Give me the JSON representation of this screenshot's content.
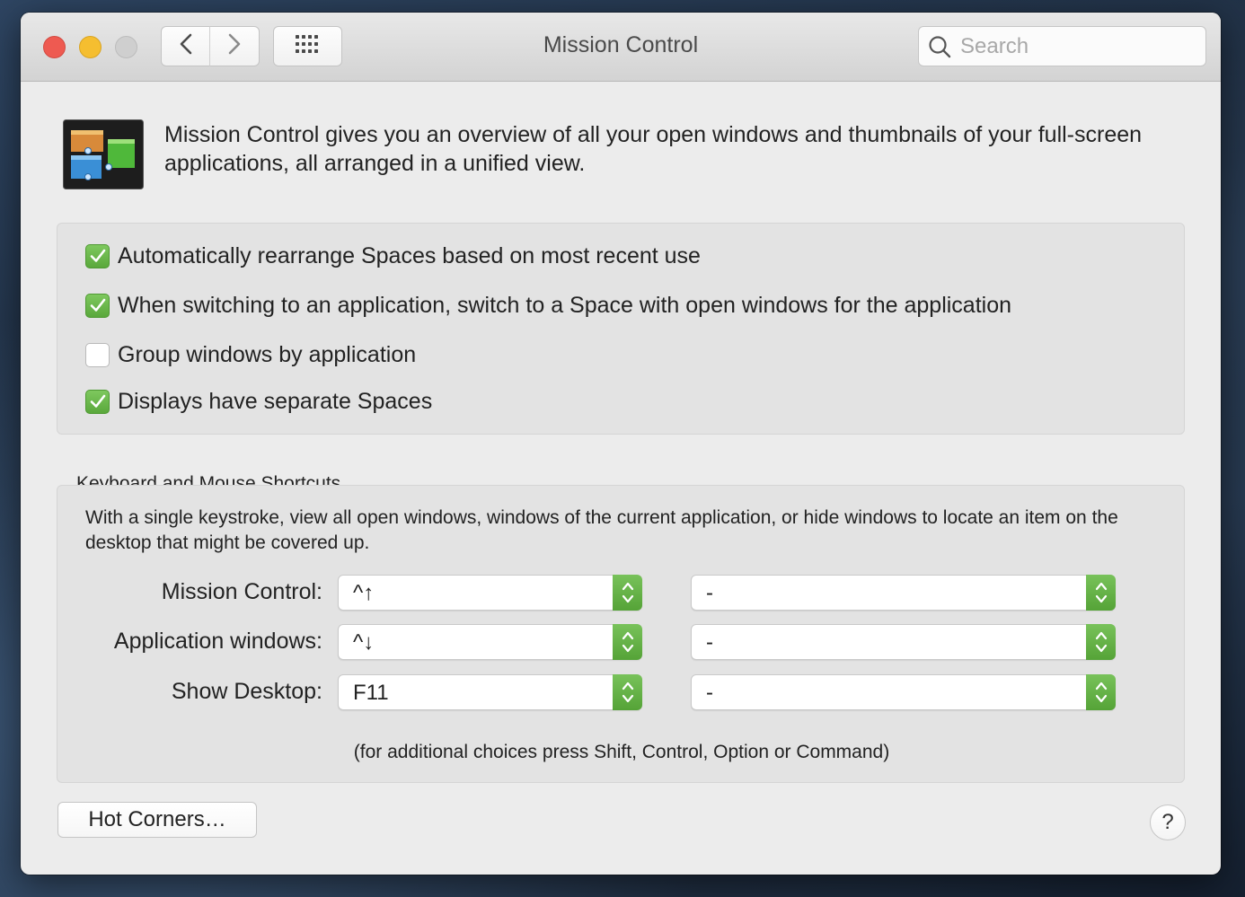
{
  "window": {
    "title": "Mission Control",
    "traffic_lights": [
      "close",
      "minimize",
      "zoom"
    ]
  },
  "toolbar": {
    "back_icon": "chevron-left-icon",
    "forward_icon": "chevron-right-icon",
    "show_all_icon": "grid-icon",
    "search": {
      "placeholder": "Search",
      "value": ""
    }
  },
  "intro": {
    "text": "Mission Control gives you an overview of all your open windows and thumbnails of your full-screen applications, all arranged in a unified view."
  },
  "options": [
    {
      "label": "Automatically rearrange Spaces based on most recent use",
      "checked": true
    },
    {
      "label": "When switching to an application, switch to a Space with open windows for the application",
      "checked": true
    },
    {
      "label": "Group windows by application",
      "checked": false
    },
    {
      "label": "Displays have separate Spaces",
      "checked": true
    }
  ],
  "shortcuts": {
    "section_label": "Keyboard and Mouse Shortcuts",
    "description": "With a single keystroke, view all open windows, windows of the current application, or hide windows to locate an item on the desktop that might be covered up.",
    "rows": [
      {
        "label": "Mission Control:",
        "keyboard": "^↑",
        "mouse": "-"
      },
      {
        "label": "Application windows:",
        "keyboard": "^↓",
        "mouse": "-"
      },
      {
        "label": "Show Desktop:",
        "keyboard": "F11",
        "mouse": "-"
      }
    ],
    "footnote": "(for additional choices press Shift, Control, Option or Command)"
  },
  "buttons": {
    "hot_corners": "Hot Corners…",
    "help": "?"
  },
  "colors": {
    "accent_green": "#5fae3f",
    "close": "#ee5a51",
    "minimize": "#f5be30",
    "zoom_disabled": "#cfcfcf"
  }
}
